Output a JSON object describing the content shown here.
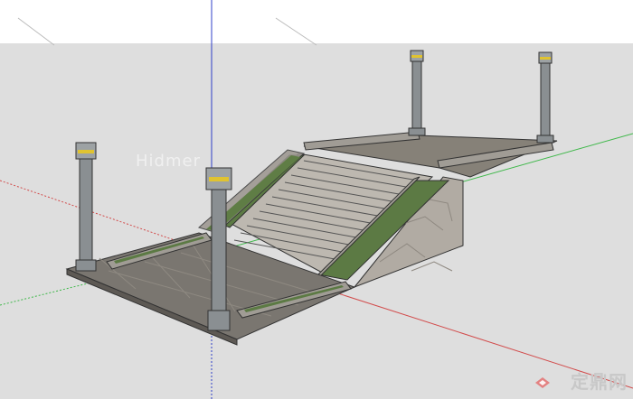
{
  "viewport": {
    "watermark_primary": "Hidmer",
    "watermark_logo_text": "定鼎网"
  },
  "colors": {
    "ground": "#dedede",
    "sky": "#ffffff",
    "axis_red": "#d24b4b",
    "axis_green": "#3fb84a",
    "axis_blue": "#2f3fc8",
    "pillar": "#8a8f92",
    "stone_floor": "#7a7670",
    "grass": "#5c7a44"
  },
  "model": {
    "pillars": 4,
    "steps": 12
  }
}
